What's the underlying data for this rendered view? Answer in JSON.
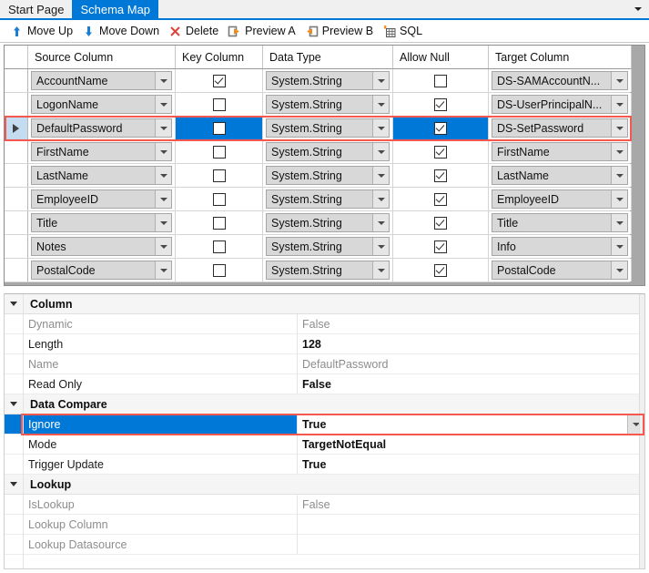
{
  "window": {
    "tabs": [
      {
        "label": "Start Page",
        "active": false
      },
      {
        "label": "Schema Map",
        "active": true
      }
    ],
    "tab_overflow_icon": "chevron-down-icon",
    "accent_color": "#0078d7",
    "selection_highlight_color": "#f4584f"
  },
  "toolbar": {
    "items": [
      {
        "label": "Move Up",
        "icon": "arrow-up-icon"
      },
      {
        "label": "Move Down",
        "icon": "arrow-down-icon"
      },
      {
        "label": "Delete",
        "icon": "x-delete-icon"
      },
      {
        "label": "Preview A",
        "icon": "preview-a-icon"
      },
      {
        "label": "Preview B",
        "icon": "preview-b-icon"
      },
      {
        "label": "SQL",
        "icon": "sql-table-icon"
      }
    ]
  },
  "grid": {
    "columns": [
      "",
      "Source Column",
      "Key Column",
      "Data Type",
      "Allow Null",
      "Target Column"
    ],
    "selected_row_index": 2,
    "rows": [
      {
        "source": "AccountName",
        "key": true,
        "type": "System.String",
        "allow_null": false,
        "target": "DS-SAMAccountN...",
        "selected": false
      },
      {
        "source": "LogonName",
        "key": false,
        "type": "System.String",
        "allow_null": true,
        "target": "DS-UserPrincipalN...",
        "selected": false
      },
      {
        "source": "DefaultPassword",
        "key": false,
        "type": "System.String",
        "allow_null": true,
        "target": "DS-SetPassword",
        "selected": true
      },
      {
        "source": "FirstName",
        "key": false,
        "type": "System.String",
        "allow_null": true,
        "target": "FirstName",
        "selected": false
      },
      {
        "source": "LastName",
        "key": false,
        "type": "System.String",
        "allow_null": true,
        "target": "LastName",
        "selected": false
      },
      {
        "source": "EmployeeID",
        "key": false,
        "type": "System.String",
        "allow_null": true,
        "target": "EmployeeID",
        "selected": false
      },
      {
        "source": "Title",
        "key": false,
        "type": "System.String",
        "allow_null": true,
        "target": "Title",
        "selected": false
      },
      {
        "source": "Notes",
        "key": false,
        "type": "System.String",
        "allow_null": true,
        "target": "Info",
        "selected": false
      },
      {
        "source": "PostalCode",
        "key": false,
        "type": "System.String",
        "allow_null": true,
        "target": "PostalCode",
        "selected": false
      }
    ]
  },
  "properties": {
    "categories": [
      {
        "name": "Column",
        "rows": [
          {
            "name": "Dynamic",
            "value": "False",
            "readonly": true
          },
          {
            "name": "Length",
            "value": "128",
            "readonly": false
          },
          {
            "name": "Name",
            "value": "DefaultPassword",
            "readonly": true
          },
          {
            "name": "Read Only",
            "value": "False",
            "readonly": false
          }
        ]
      },
      {
        "name": "Data Compare",
        "rows": [
          {
            "name": "Ignore",
            "value": "True",
            "readonly": false,
            "selected": true,
            "has_dropdown": true
          },
          {
            "name": "Mode",
            "value": "TargetNotEqual",
            "readonly": false
          },
          {
            "name": "Trigger Update",
            "value": "True",
            "readonly": false
          }
        ]
      },
      {
        "name": "Lookup",
        "rows": [
          {
            "name": "IsLookup",
            "value": "False",
            "readonly": true
          },
          {
            "name": "Lookup Column",
            "value": "",
            "readonly": true
          },
          {
            "name": "Lookup Datasource",
            "value": "",
            "readonly": true
          }
        ]
      }
    ]
  }
}
